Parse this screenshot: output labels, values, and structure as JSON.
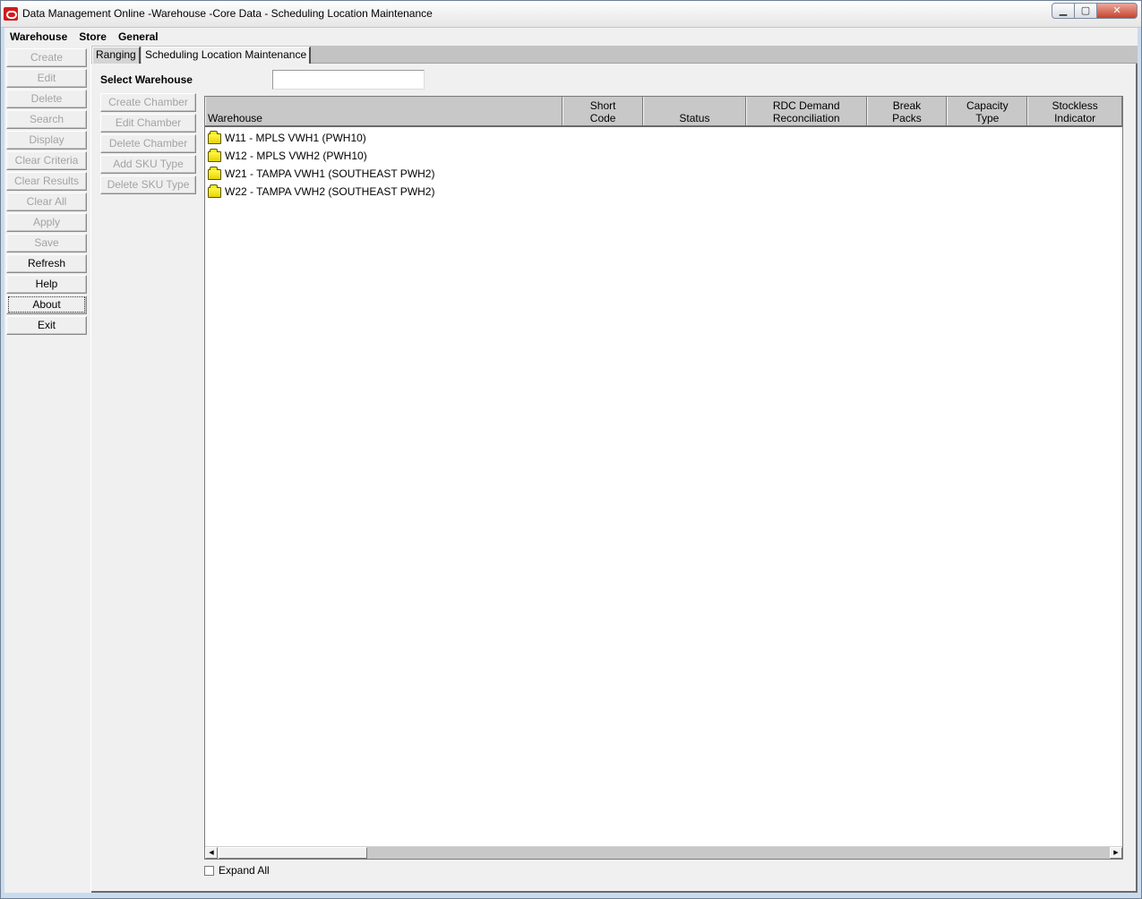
{
  "window": {
    "title": "Data Management Online -Warehouse -Core Data - Scheduling Location Maintenance",
    "minimize": "▁",
    "maximize": "▢",
    "close": "✕"
  },
  "menu": [
    "Warehouse",
    "Store",
    "General"
  ],
  "left_buttons": [
    {
      "label": "Create",
      "enabled": false
    },
    {
      "label": "Edit",
      "enabled": false
    },
    {
      "label": "Delete",
      "enabled": false
    },
    {
      "label": "Search",
      "enabled": false
    },
    {
      "label": "Display",
      "enabled": false
    },
    {
      "label": "Clear Criteria",
      "enabled": false
    },
    {
      "label": "Clear Results",
      "enabled": false
    },
    {
      "label": "Clear All",
      "enabled": false
    },
    {
      "label": "Apply",
      "enabled": false
    },
    {
      "label": "Save",
      "enabled": false
    },
    {
      "label": "Refresh",
      "enabled": true
    },
    {
      "label": "Help",
      "enabled": true
    },
    {
      "label": "About",
      "enabled": true,
      "focused": true
    },
    {
      "label": "Exit",
      "enabled": true
    }
  ],
  "tabs": [
    {
      "label": "Ranging",
      "active": false
    },
    {
      "label": "Scheduling Location Maintenance",
      "active": true
    }
  ],
  "select_warehouse": {
    "label": "Select Warehouse",
    "value": ""
  },
  "chamber_buttons": [
    "Create Chamber",
    "Edit Chamber",
    "Delete Chamber",
    "Add SKU Type",
    "Delete SKU Type"
  ],
  "table": {
    "columns": [
      {
        "lines": [
          "Warehouse"
        ]
      },
      {
        "lines": [
          "Short",
          "Code"
        ]
      },
      {
        "lines": [
          "Status"
        ]
      },
      {
        "lines": [
          "RDC Demand",
          "Reconciliation"
        ]
      },
      {
        "lines": [
          "Break",
          "Packs"
        ]
      },
      {
        "lines": [
          "Capacity",
          "Type"
        ]
      },
      {
        "lines": [
          "Stockless",
          "Indicator"
        ]
      }
    ],
    "rows": [
      {
        "label": "W11 - MPLS VWH1 (PWH10)",
        "icon": "folder-icon"
      },
      {
        "label": "W12 - MPLS VWH2 (PWH10)",
        "icon": "folder-icon"
      },
      {
        "label": "W21 - TAMPA VWH1 (SOUTHEAST PWH2)",
        "icon": "folder-icon"
      },
      {
        "label": "W22 - TAMPA VWH2 (SOUTHEAST PWH2)",
        "icon": "folder-icon"
      }
    ]
  },
  "scroll": {
    "left_arrow": "◀",
    "right_arrow": "▶"
  },
  "expand_all": {
    "label": "Expand All",
    "checked": false
  },
  "colors": {
    "folder": "#f5ea1a",
    "header_bg": "#c8c8c8",
    "panel_bg": "#f0f0f0"
  }
}
